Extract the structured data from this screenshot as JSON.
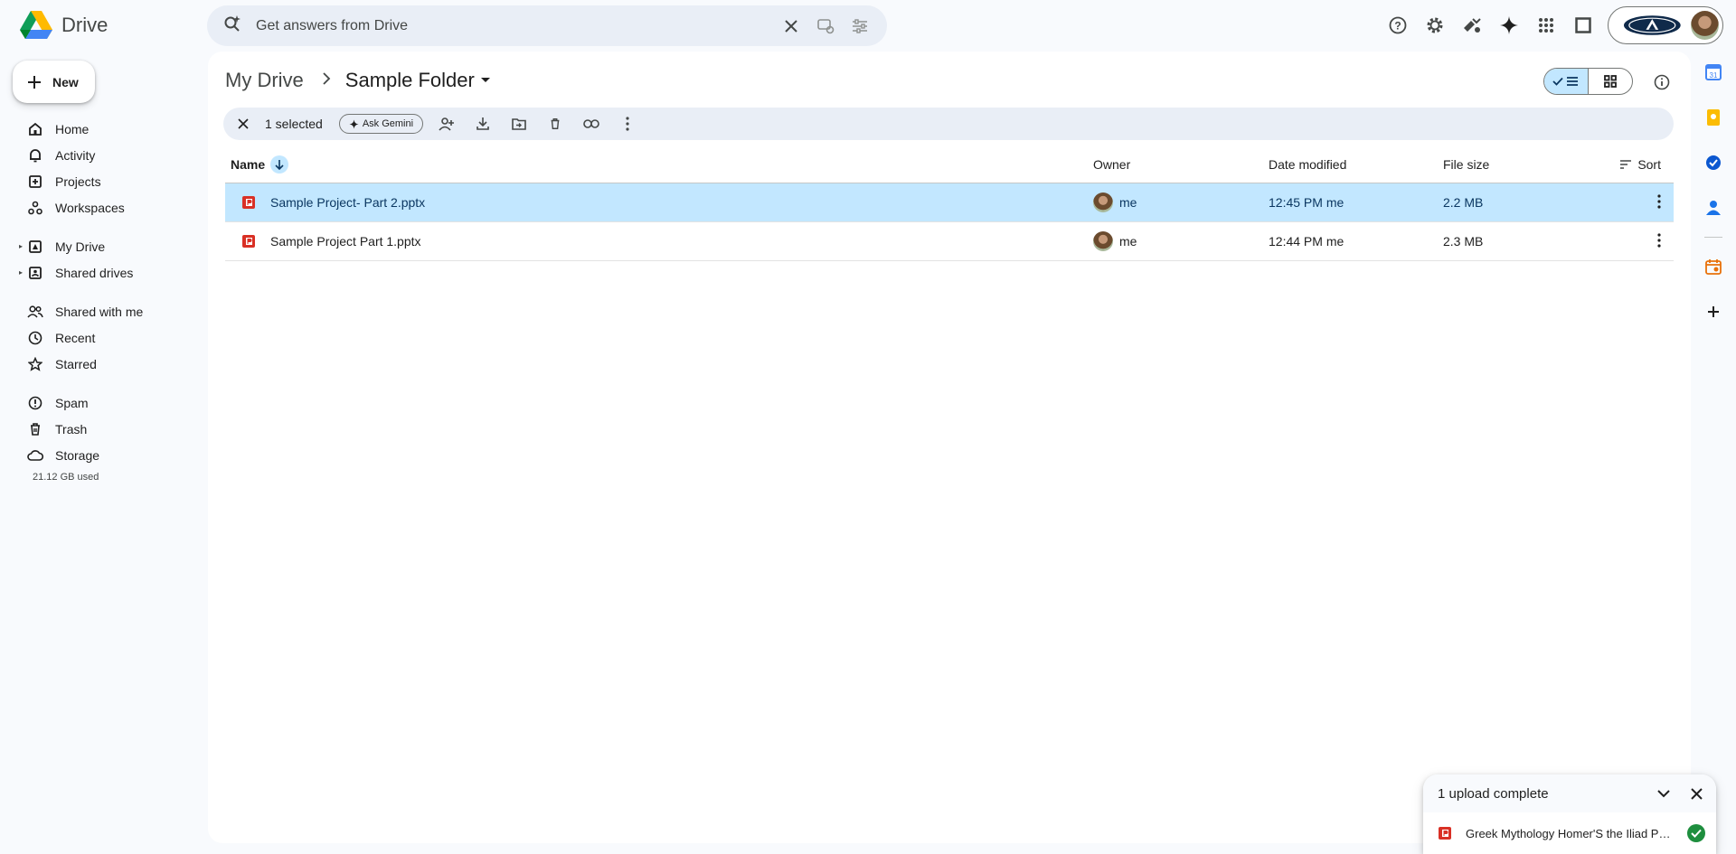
{
  "app": {
    "title": "Drive"
  },
  "search": {
    "placeholder": "Get answers from Drive"
  },
  "sidebar": {
    "new_label": "New",
    "items": [
      {
        "label": "Home"
      },
      {
        "label": "Activity"
      },
      {
        "label": "Projects"
      },
      {
        "label": "Workspaces"
      },
      {
        "label": "My Drive"
      },
      {
        "label": "Shared drives"
      },
      {
        "label": "Shared with me"
      },
      {
        "label": "Recent"
      },
      {
        "label": "Starred"
      },
      {
        "label": "Spam"
      },
      {
        "label": "Trash"
      },
      {
        "label": "Storage"
      }
    ],
    "storage_used": "21.12 GB used"
  },
  "breadcrumb": {
    "root": "My Drive",
    "current": "Sample Folder"
  },
  "selection": {
    "count_label": "1 selected",
    "ask_gemini": "Ask Gemini"
  },
  "table": {
    "headers": {
      "name": "Name",
      "owner": "Owner",
      "modified": "Date modified",
      "size": "File size",
      "sort": "Sort"
    },
    "rows": [
      {
        "name": "Sample Project- Part 2.pptx",
        "owner": "me",
        "modified": "12:45 PM me",
        "size": "2.2 MB",
        "selected": true
      },
      {
        "name": "Sample Project Part 1.pptx",
        "owner": "me",
        "modified": "12:44 PM me",
        "size": "2.3 MB",
        "selected": false
      }
    ]
  },
  "upload": {
    "title": "1 upload complete",
    "file": "Greek Mythology Homer'S the Iliad Pr..."
  },
  "colors": {
    "accent": "#0b57d0",
    "selected_bg": "#c2e7ff",
    "pptx": "#d93025",
    "success": "#1e8e3e"
  }
}
